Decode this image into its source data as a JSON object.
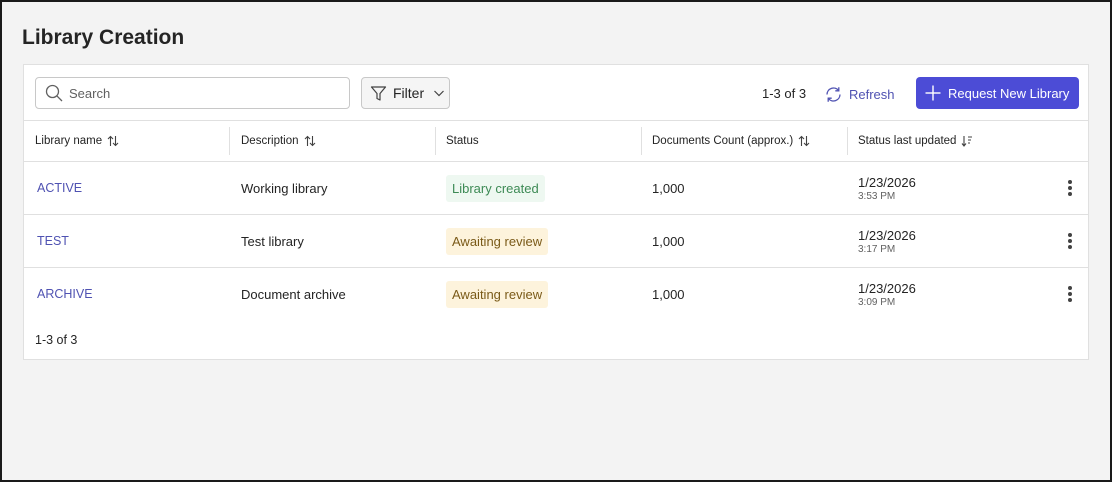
{
  "page": {
    "title": "Library Creation"
  },
  "toolbar": {
    "search_placeholder": "Search",
    "filter_label": "Filter",
    "count": "1-3 of 3",
    "refresh_label": "Refresh",
    "request_label": "Request New Library"
  },
  "table": {
    "columns": [
      {
        "label": "Library name",
        "sort": "sortable"
      },
      {
        "label": "Description",
        "sort": "sortable"
      },
      {
        "label": "Status",
        "sort": "none"
      },
      {
        "label": "Documents Count (approx.)",
        "sort": "sortable"
      },
      {
        "label": "Status last updated",
        "sort": "descending"
      }
    ],
    "rows": [
      {
        "name": "ACTIVE",
        "description": "Working library",
        "status": "Library created",
        "status_color": "green",
        "documents": "1,000",
        "date": "1/23/2026",
        "time": "3:53 PM"
      },
      {
        "name": "TEST",
        "description": "Test library",
        "status": "Awaiting review",
        "status_color": "yellow",
        "documents": "1,000",
        "date": "1/23/2026",
        "time": "3:17 PM"
      },
      {
        "name": "ARCHIVE",
        "description": "Document archive",
        "status": "Awaiting review",
        "status_color": "yellow",
        "documents": "1,000",
        "date": "1/23/2026",
        "time": "3:09 PM"
      }
    ],
    "footer_count": "1-3 of 3"
  },
  "colors": {
    "accent": "#4c4cd6",
    "link": "#4f52b2",
    "success_bg": "#eef8f1",
    "warning_bg": "#fdf3dc"
  },
  "icons": {
    "search": "search-icon",
    "filter": "filter-icon",
    "refresh": "refresh-icon",
    "add": "plus-icon",
    "sort": "sort-icon",
    "more": "more-vertical-icon"
  }
}
